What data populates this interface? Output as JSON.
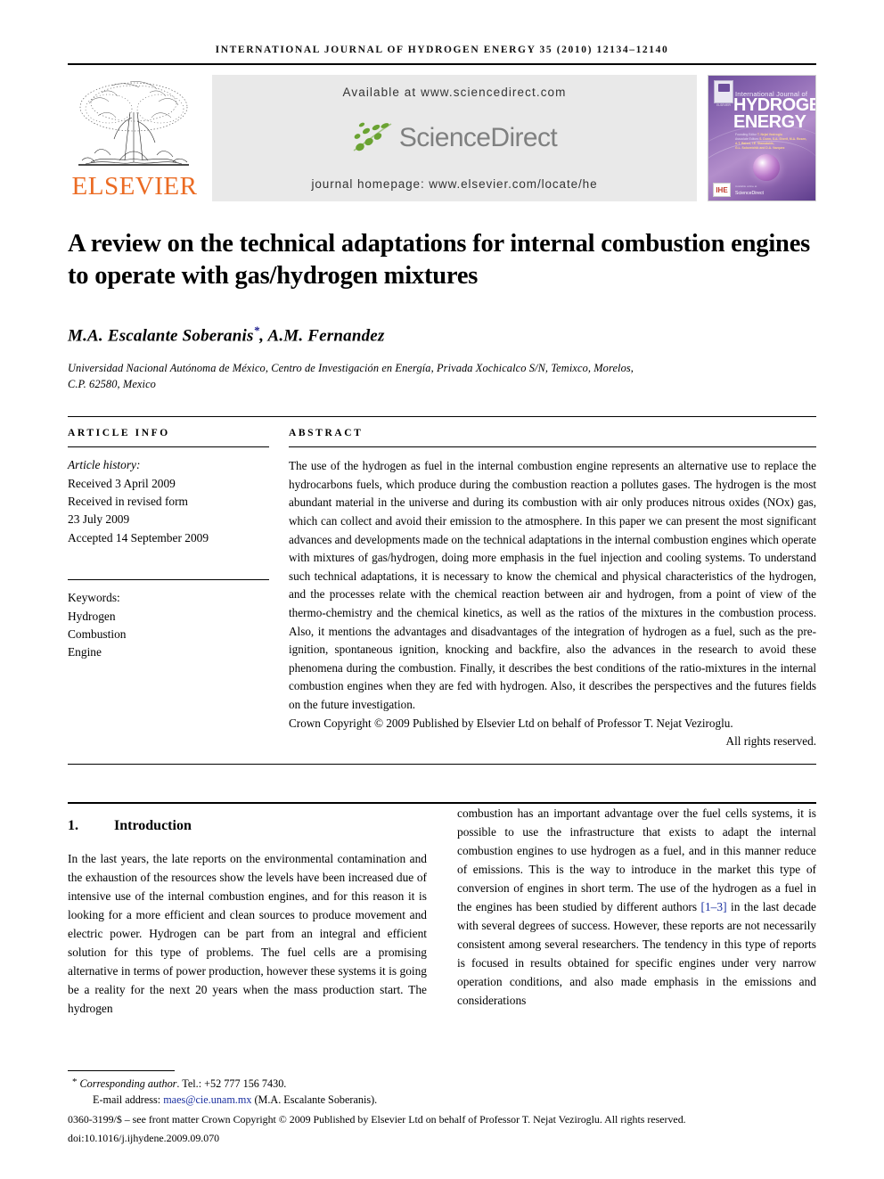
{
  "running_head": "International Journal of Hydrogen Energy 35 (2010) 12134–12140",
  "masthead": {
    "publisher_logo_text": "ELSEVIER",
    "available_at": "Available at www.sciencedirect.com",
    "sciencedirect_logo_text": "ScienceDirect",
    "journal_homepage": "journal homepage: www.elsevier.com/locate/he",
    "cover": {
      "line_small": "International Journal of",
      "line_big_1": "HYDROGEN",
      "line_big_2": "ENERGY",
      "editor_label_1": "Founding Editor",
      "editor_name_1": "T. Nejat Veziroglu",
      "editor_label_2": "Associate Editors",
      "editor_name_2": "S. Dunn, S.A. Sherif, M.A. Rosen,",
      "editor_name_3": "A.T. Raissi, I.E. Stamatakis,",
      "editor_name_4": "G.L. Soloveichik and D.A. Vazquez",
      "ihe_badge": "IHE",
      "sd_caption_small": "Available online at",
      "sd_caption": "ScienceDirect"
    }
  },
  "title": "A review on the technical adaptations for internal combustion engines to operate with gas/hydrogen mixtures",
  "authors": "M.A. Escalante Soberanis",
  "authors_star": "*",
  "authors_rest": ", A.M. Fernandez",
  "affiliation_line1": "Universidad Nacional Autónoma de México, Centro de Investigación en Energía, Privada Xochicalco S/N, Temixco, Morelos,",
  "affiliation_line2": "C.P. 62580, Mexico",
  "article_info": {
    "heading": "ARTICLE INFO",
    "history_label": "Article history:",
    "history": [
      "Received 3 April 2009",
      "Received in revised form",
      "23 July 2009",
      "Accepted 14 September 2009"
    ],
    "keywords_label": "Keywords:",
    "keywords": [
      "Hydrogen",
      "Combustion",
      "Engine"
    ]
  },
  "abstract": {
    "heading": "ABSTRACT",
    "text": "The use of the hydrogen as fuel in the internal combustion engine represents an alternative use to replace the hydrocarbons fuels, which produce during the combustion reaction a pollutes gases. The hydrogen is the most abundant material in the universe and during its combustion with air only produces nitrous oxides (NOx) gas, which can collect and avoid their emission to the atmosphere. In this paper we can present the most significant advances and developments made on the technical adaptations in the internal combustion engines which operate with mixtures of gas/hydrogen, doing more emphasis in the fuel injection and cooling systems. To understand such technical adaptations, it is necessary to know the chemical and physical characteristics of the hydrogen, and the processes relate with the chemical reaction between air and hydrogen, from a point of view of the thermo-chemistry and the chemical kinetics, as well as the ratios of the mixtures in the combustion process. Also, it mentions the advantages and disadvantages of the integration of hydrogen as a fuel, such as the pre-ignition, spontaneous ignition, knocking and backfire, also the advances in the research to avoid these phenomena during the combustion. Finally, it describes the best conditions of the ratio-mixtures in the internal combustion engines when they are fed with hydrogen. Also, it describes the perspectives and the futures fields on the future investigation.",
    "copyright_line": "Crown Copyright © 2009 Published by Elsevier Ltd on behalf of Professor T. Nejat Veziroglu.",
    "rights_line": "All rights reserved."
  },
  "body": {
    "section_number": "1.",
    "section_title": "Introduction",
    "left_column": "In the last years, the late reports on the environmental contamination and the exhaustion of the resources show the levels have been increased due of intensive use of the internal combustion engines, and for this reason it is looking for a more efficient and clean sources to produce movement and electric power. Hydrogen can be part from an integral and efficient solution for this type of problems. The fuel cells are a promising alternative in terms of power production, however these systems it is going be a reality for the next 20 years when the mass production start. The hydrogen",
    "right_column_pre": "combustion has an important advantage over the fuel cells systems, it is possible to use the infrastructure that exists to adapt the internal combustion engines to use hydrogen as a fuel, and in this manner reduce of emissions. This is the way to introduce in the market this type of conversion of engines in short term. The use of the hydrogen as a fuel in the engines has been studied by different authors ",
    "right_column_ref": "[1–3]",
    "right_column_post": " in the last decade with several degrees of success. However, these reports are not necessarily consistent among several researchers. The tendency in this type of reports is focused in results obtained for specific engines under very narrow operation conditions, and also made emphasis in the emissions and considerations"
  },
  "footnotes": {
    "corresponding_label": "Corresponding author",
    "corresponding_tel": ". Tel.: +52 777 156 7430.",
    "email_label": "E-mail address: ",
    "email": "maes@cie.unam.mx",
    "email_owner": " (M.A. Escalante Soberanis).",
    "issn_line": "0360-3199/$ – see front matter Crown Copyright © 2009 Published by Elsevier Ltd on behalf of Professor T. Nejat Veziroglu. All rights reserved.",
    "doi_line": "doi:10.1016/j.ijhydene.2009.09.070"
  },
  "colors": {
    "elsevier_orange": "#EB6B23",
    "sciencedirect_gray": "#7f8080",
    "sciencedirect_green": "#6aa332",
    "link_blue": "#1a2fa0",
    "banner_gray": "#e9e9e9"
  }
}
